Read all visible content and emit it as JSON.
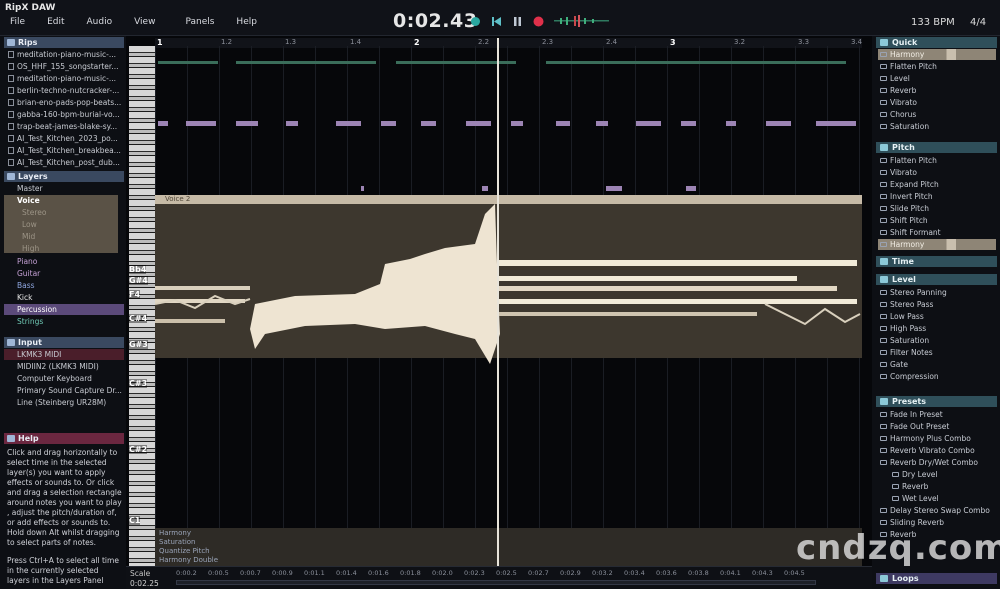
{
  "app": {
    "title": "RipX DAW"
  },
  "menu": [
    "File",
    "Edit",
    "Audio",
    "View",
    "Panels",
    "Help"
  ],
  "transport": {
    "time": "0:02.43",
    "bpm": "133 BPM",
    "signature": "4/4"
  },
  "colors": {
    "accent": "#3a4960",
    "voice": "#c6baa6",
    "purple_notes": "#9c84b4",
    "help": "#6b2740"
  },
  "left": {
    "rips_title": "Rips",
    "rips": [
      "meditation-piano-music-...",
      "OS_HHF_155_songstarter...",
      "meditation-piano-music-...",
      "berlin-techno-nutcracker-...",
      "brian-eno-pads-pop-beats...",
      "gabba-160-bpm-burial-vo...",
      "trap-beat-james-blake-sy...",
      "AI_Test_Kitchen_2023_po...",
      "AI_Test_Kitchen_breakbea...",
      "AI_Test_Kitchen_post_dub..."
    ],
    "layers_title": "Layers",
    "layers": {
      "master": "Master",
      "voice": "Voice",
      "voice_sub": [
        "Stereo",
        "Low",
        "Mid",
        "High"
      ],
      "others": [
        "Piano",
        "Guitar",
        "Bass",
        "Kick",
        "Percussion",
        "Strings"
      ]
    },
    "input_title": "Input",
    "inputs": [
      "LKMK3 MIDI",
      "MIDIIN2 (LKMK3 MIDI)",
      "Computer Keyboard",
      "Primary Sound Capture Dr...",
      "Line (Steinberg UR28M)"
    ],
    "help_title": "Help",
    "help_text_1": "Click and drag horizontally to select time in the selected layer(s) you want to apply effects or sounds to. Or click and drag a selection rectangle around notes you want to play , adjust the pitch/duration of, or add effects or sounds to. Hold down Alt whilst dragging to select parts of notes.",
    "help_text_2": "Press Ctrl+A to select all time in the currently selected layers in the Layers Panel"
  },
  "main": {
    "ruler": [
      "1",
      "1.2",
      "1.3",
      "1.4",
      "2",
      "2.2",
      "2.3",
      "2.4",
      "3",
      "3.2",
      "3.3",
      "3.4"
    ],
    "note_labels": [
      "Bb4",
      "G#4",
      "F4",
      "C#4",
      "G#3",
      "C#3",
      "C#2",
      "C1"
    ],
    "voice_label": "Voice 2",
    "bottom_labels": [
      "Harmony",
      "Saturation",
      "Quantize Pitch",
      "Harmony Double"
    ],
    "timeline_scale": "Scale",
    "timeline_time": "0:02.25",
    "timeline_ticks": [
      "0:00.2",
      "0:00.5",
      "0:00.7",
      "0:00.9",
      "0:01.1",
      "0:01.4",
      "0:01.6",
      "0:01.8",
      "0:02.0",
      "0:02.3",
      "0:02.5",
      "0:02.7",
      "0:02.9",
      "0:03.2",
      "0:03.4",
      "0:03.6",
      "0:03.8",
      "0:04.1",
      "0:04.3",
      "0:04.5"
    ]
  },
  "right": {
    "quick_title": "Quick",
    "quick": [
      "Harmony",
      "Flatten Pitch",
      "Level",
      "Reverb",
      "Vibrato",
      "Chorus",
      "Saturation"
    ],
    "pitch_title": "Pitch",
    "pitch": [
      "Flatten Pitch",
      "Vibrato",
      "Expand Pitch",
      "Invert Pitch",
      "Slide Pitch",
      "Shift Pitch",
      "Shift Formant",
      "Harmony"
    ],
    "time_title": "Time",
    "level_title": "Level",
    "level": [
      "Stereo Panning",
      "Stereo Pass",
      "Low Pass",
      "High Pass",
      "Saturation",
      "Filter Notes",
      "Gate",
      "Compression"
    ],
    "presets_title": "Presets",
    "presets": [
      "Fade In Preset",
      "Fade Out Preset",
      "Harmony Plus Combo",
      "Reverb Vibrato Combo",
      "Reverb Dry/Wet Combo",
      "Dry Level",
      "Reverb",
      "Wet Level",
      "Delay Stereo Swap Combo",
      "Sliding Reverb",
      "Reverb"
    ],
    "loops_title": "Loops"
  },
  "watermark": "cndzq.com"
}
